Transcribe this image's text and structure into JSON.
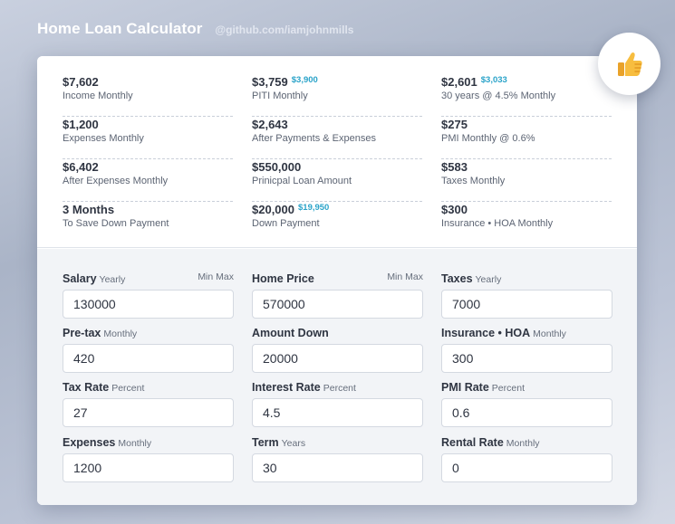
{
  "header": {
    "title": "Home Loan Calculator",
    "link": "@github.com/iamjohnmills"
  },
  "summary": {
    "col1": [
      {
        "value": "$7,602",
        "alt": "",
        "label": "Income Monthly"
      },
      {
        "value": "$1,200",
        "alt": "",
        "label": "Expenses Monthly"
      },
      {
        "value": "$6,402",
        "alt": "",
        "label": "After Expenses Monthly"
      },
      {
        "value": "3 Months",
        "alt": "",
        "label": "To Save Down Payment"
      }
    ],
    "col2": [
      {
        "value": "$3,759",
        "alt": "$3,900",
        "label": "PITI Monthly"
      },
      {
        "value": "$2,643",
        "alt": "",
        "label": "After Payments & Expenses"
      },
      {
        "value": "$550,000",
        "alt": "",
        "label": "Prinicpal Loan Amount"
      },
      {
        "value": "$20,000",
        "alt": "$19,950",
        "label": "Down Payment"
      }
    ],
    "col3": [
      {
        "value": "$2,601",
        "alt": "$3,033",
        "label": "30 years @ 4.5% Monthly"
      },
      {
        "value": "$275",
        "alt": "",
        "label": "PMI Monthly @ 0.6%"
      },
      {
        "value": "$583",
        "alt": "",
        "label": "Taxes Monthly"
      },
      {
        "value": "$300",
        "alt": "",
        "label": "Insurance • HOA Monthly"
      }
    ]
  },
  "inputs": {
    "salary": {
      "name": "Salary",
      "unit": "Yearly",
      "minmax": "Min Max",
      "value": "130000"
    },
    "home_price": {
      "name": "Home Price",
      "unit": "",
      "minmax": "Min Max",
      "value": "570000"
    },
    "taxes": {
      "name": "Taxes",
      "unit": "Yearly",
      "value": "7000"
    },
    "pretax": {
      "name": "Pre-tax",
      "unit": "Monthly",
      "value": "420"
    },
    "amount_down": {
      "name": "Amount Down",
      "unit": "",
      "value": "20000"
    },
    "insurance_hoa": {
      "name": "Insurance • HOA",
      "unit": "Monthly",
      "value": "300"
    },
    "tax_rate": {
      "name": "Tax Rate",
      "unit": "Percent",
      "value": "27"
    },
    "interest_rate": {
      "name": "Interest Rate",
      "unit": "Percent",
      "value": "4.5"
    },
    "pmi_rate": {
      "name": "PMI Rate",
      "unit": "Percent",
      "value": "0.6"
    },
    "expenses": {
      "name": "Expenses",
      "unit": "Monthly",
      "value": "1200"
    },
    "term": {
      "name": "Term",
      "unit": "Years",
      "value": "30"
    },
    "rental_rate": {
      "name": "Rental Rate",
      "unit": "Monthly",
      "value": "0"
    }
  },
  "badge": {
    "icon": "thumbs-up-icon",
    "color": "#f5b53a"
  },
  "colors": {
    "accent": "#2aa3c9",
    "text": "#2f3542",
    "muted": "#5c6473"
  }
}
